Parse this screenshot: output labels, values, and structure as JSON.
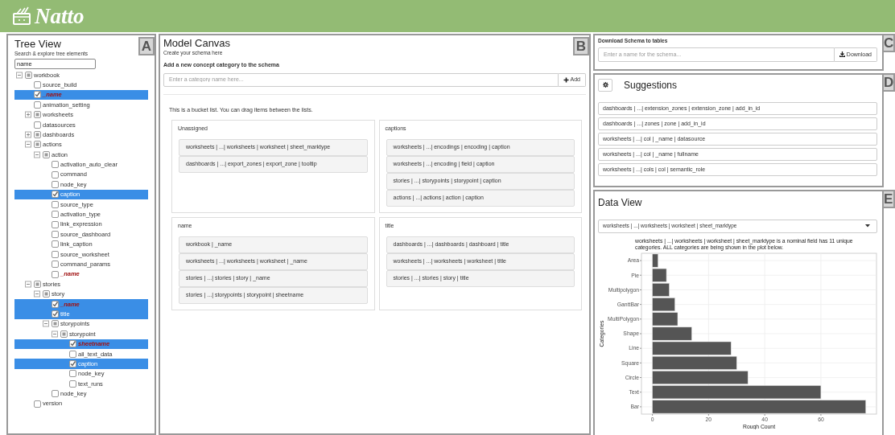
{
  "header": {
    "logo": "Natto"
  },
  "tree_view": {
    "title": "Tree View",
    "subtitle": "Search & explore tree elements",
    "badge": "A",
    "search": {
      "value": "name"
    },
    "items": [
      {
        "label": "workbook",
        "kind": "group",
        "indeterminate": true,
        "expanded": true,
        "children": [
          {
            "label": "source_build",
            "kind": "leaf",
            "checked": false,
            "match": false
          },
          {
            "label": "_name",
            "kind": "leaf",
            "checked": true,
            "match": true
          },
          {
            "label": "animation_setting",
            "kind": "leaf",
            "checked": false,
            "match": false
          },
          {
            "label": "worksheets",
            "kind": "group",
            "indeterminate": true,
            "expanded": false
          },
          {
            "label": "datasources",
            "kind": "leaf",
            "checked": false,
            "match": false
          },
          {
            "label": "dashboards",
            "kind": "group",
            "indeterminate": true,
            "expanded": false
          },
          {
            "label": "actions",
            "kind": "group",
            "indeterminate": true,
            "expanded": true,
            "children": [
              {
                "label": "action",
                "kind": "group",
                "indeterminate": true,
                "expanded": true,
                "children": [
                  {
                    "label": "activation_auto_clear",
                    "kind": "leaf",
                    "checked": false,
                    "match": false
                  },
                  {
                    "label": "command",
                    "kind": "leaf",
                    "checked": false,
                    "match": false
                  },
                  {
                    "label": "node_key",
                    "kind": "leaf",
                    "checked": false,
                    "match": false
                  },
                  {
                    "label": "caption",
                    "kind": "leaf",
                    "checked": true,
                    "match": false
                  },
                  {
                    "label": "source_type",
                    "kind": "leaf",
                    "checked": false,
                    "match": false
                  },
                  {
                    "label": "activation_type",
                    "kind": "leaf",
                    "checked": false,
                    "match": false
                  },
                  {
                    "label": "link_expression",
                    "kind": "leaf",
                    "checked": false,
                    "match": false
                  },
                  {
                    "label": "source_dashboard",
                    "kind": "leaf",
                    "checked": false,
                    "match": false
                  },
                  {
                    "label": "link_caption",
                    "kind": "leaf",
                    "checked": false,
                    "match": false
                  },
                  {
                    "label": "source_worksheet",
                    "kind": "leaf",
                    "checked": false,
                    "match": false
                  },
                  {
                    "label": "command_params",
                    "kind": "leaf",
                    "checked": false,
                    "match": false
                  },
                  {
                    "label": "_name",
                    "kind": "leaf",
                    "checked": false,
                    "match": true
                  }
                ]
              }
            ]
          },
          {
            "label": "stories",
            "kind": "group",
            "indeterminate": true,
            "expanded": true,
            "children": [
              {
                "label": "story",
                "kind": "group",
                "indeterminate": true,
                "expanded": true,
                "children": [
                  {
                    "label": "_name",
                    "kind": "leaf",
                    "checked": true,
                    "match": true
                  },
                  {
                    "label": "title",
                    "kind": "leaf",
                    "checked": true,
                    "match": false
                  },
                  {
                    "label": "storypoints",
                    "kind": "group",
                    "indeterminate": true,
                    "expanded": true,
                    "children": [
                      {
                        "label": "storypoint",
                        "kind": "group",
                        "indeterminate": true,
                        "expanded": true,
                        "children": [
                          {
                            "label": "sheetname",
                            "kind": "leaf",
                            "checked": true,
                            "match": true
                          },
                          {
                            "label": "all_text_data",
                            "kind": "leaf",
                            "checked": false,
                            "match": false
                          },
                          {
                            "label": "caption",
                            "kind": "leaf",
                            "checked": true,
                            "match": false
                          },
                          {
                            "label": "node_key",
                            "kind": "leaf",
                            "checked": false,
                            "match": false
                          },
                          {
                            "label": "text_runs",
                            "kind": "leaf",
                            "checked": false,
                            "match": false
                          }
                        ]
                      }
                    ]
                  },
                  {
                    "label": "node_key",
                    "kind": "leaf",
                    "checked": false,
                    "match": false
                  }
                ]
              }
            ]
          },
          {
            "label": "version",
            "kind": "leaf",
            "checked": false,
            "match": false
          }
        ]
      }
    ]
  },
  "model_canvas": {
    "title": "Model Canvas",
    "subtitle": "Create your schema here",
    "badge": "B",
    "add_label": "Add a new concept category to the schema",
    "category_input": {
      "placeholder": "Enter a category name here..."
    },
    "add_button": "Add",
    "bucket_intro": "This is a bucket list. You can drag items between the lists.",
    "buckets": [
      {
        "title": "Unassigned",
        "items": [
          "worksheets | ...| worksheets | worksheet | sheet_marktype",
          "dashboards | ...| export_zones | export_zone | tooltip"
        ]
      },
      {
        "title": "captions",
        "items": [
          "worksheets | ...| encodings | encoding | caption",
          "worksheets | ...| encoding | field | caption",
          "stories | ...| storypoints | storypoint | caption",
          "actions | ...| actions | action | caption"
        ]
      },
      {
        "title": "name",
        "items": [
          "workbook | _name",
          "worksheets | ...| worksheets | worksheet | _name",
          "stories | ...| stories | story | _name",
          "stories | ...| storypoints | storypoint | sheetname"
        ]
      },
      {
        "title": "title",
        "items": [
          "dashboards | ...| dashboards | dashboard | title",
          "worksheets | ...| worksheets | worksheet | title",
          "stories | ...| stories | story | title"
        ]
      }
    ]
  },
  "download": {
    "badge": "C",
    "title": "Download Schema to tables",
    "schema_input": {
      "placeholder": "Enter a name for the schema..."
    },
    "button": "Download"
  },
  "suggestions": {
    "badge": "D",
    "title": "Suggestions",
    "items": [
      "dashboards | ...| extension_zones | extension_zone | add_in_id",
      "dashboards | ...| zones | zone | add_in_id",
      "worksheets | ...| col | _name | datasource",
      "worksheets | ...| col | _name | fullname",
      "worksheets | ...| cols | col | semantic_role"
    ]
  },
  "data_view": {
    "badge": "E",
    "title": "Data View",
    "select": {
      "value": "worksheets | ...| worksheets | worksheet | sheet_marktype"
    },
    "chart_data": {
      "type": "bar",
      "orientation": "horizontal",
      "title": "worksheets | ...| worksheets | worksheet | sheet_marktype is a nominal field has 11 unique categories. ALL categories are being shown in the plot below.",
      "xlabel": "Rough Count",
      "ylabel": "Categories",
      "categories": [
        "Area",
        "Pie",
        "Multipolygon",
        "GanttBar",
        "MultiPolygon",
        "Shape",
        "Line",
        "Square",
        "Circle",
        "Text",
        "Bar"
      ],
      "values": [
        2,
        5,
        6,
        8,
        9,
        14,
        28,
        30,
        34,
        60,
        76
      ],
      "xlim": [
        -3.9,
        79.8
      ],
      "xticks": [
        0,
        20,
        40,
        60
      ],
      "grid": true
    }
  }
}
